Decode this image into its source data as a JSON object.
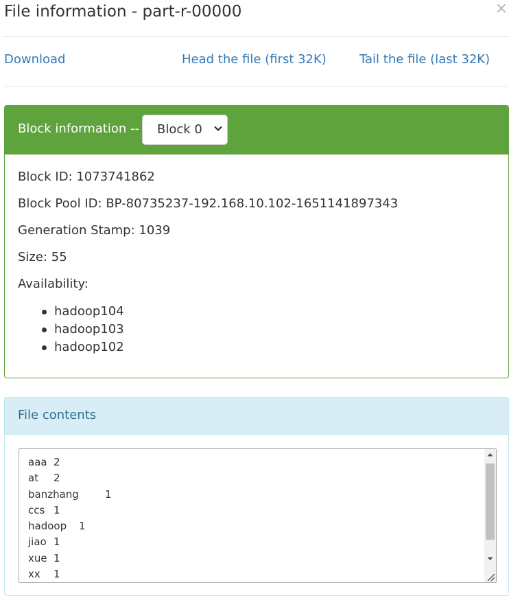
{
  "modal": {
    "title": "File information - part-r-00000",
    "close_label": "×"
  },
  "links": {
    "download": "Download",
    "head": "Head the file (first 32K)",
    "tail": "Tail the file (last 32K)"
  },
  "block_panel": {
    "heading": "Block information --",
    "selected_block": "Block 0",
    "block_id": "Block ID: 1073741862",
    "block_pool_id": "Block Pool ID: BP-80735237-192.168.10.102-1651141897343",
    "generation_stamp": "Generation Stamp: 1039",
    "size": "Size: 55",
    "availability_label": "Availability:",
    "hosts": [
      "hadoop104",
      "hadoop103",
      "hadoop102"
    ]
  },
  "file_panel": {
    "heading": "File contents",
    "lines": [
      {
        "word": "aaa",
        "count": "2"
      },
      {
        "word": "at",
        "count": "2"
      },
      {
        "word": "banzhang",
        "count": "1"
      },
      {
        "word": "ccs",
        "count": "1"
      },
      {
        "word": "hadoop",
        "count": "1"
      },
      {
        "word": "jiao",
        "count": "1"
      },
      {
        "word": "xue",
        "count": "1"
      },
      {
        "word": "xx",
        "count": "1"
      }
    ]
  },
  "colors": {
    "block_heading_bg": "#5fa33d",
    "file_heading_bg": "#d9edf7",
    "link": "#337ab7"
  },
  "icons": {
    "close": "close-icon",
    "select_chevron": "chevron-down-icon",
    "scroll_up": "arrow-up-icon",
    "scroll_down": "arrow-down-icon",
    "resize": "resize-grip-icon"
  }
}
